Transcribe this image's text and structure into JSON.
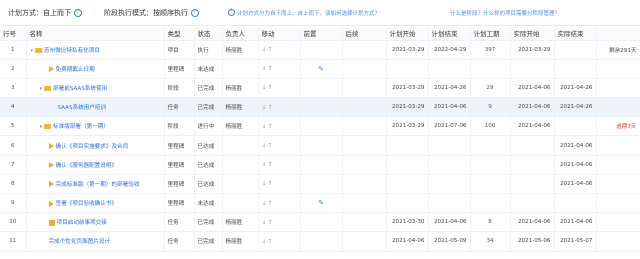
{
  "topbar": {
    "plan_mode_label": "计划方式：",
    "plan_mode_value": "自上而下",
    "stage_mode_label": "阶段执行模式：",
    "stage_mode_value": "按顺序执行",
    "hint_text": "计划方式分为自下而上、自上而下，该如何选择计划方式？",
    "hint2_text": "什么是阶段？什么样的项目需要分阶段管理？"
  },
  "columns": {
    "index": "行号",
    "name": "名称",
    "type": "类型",
    "status": "状态",
    "owner": "负责人",
    "move": "移动",
    "prev": "前置",
    "next": "后续",
    "plan_start": "计划开始",
    "plan_end": "计划结束",
    "plan_days": "计划工期",
    "actual_start": "实际开始",
    "actual_end": "实际结束"
  },
  "rows": [
    {
      "index": "1",
      "name": "苏州微比特私有化项目",
      "icon": "folder-icon",
      "indent": 0,
      "toggle": "▾",
      "type": "项目",
      "status": "执行",
      "owner": "杨丽胜",
      "move": "↓↑",
      "edit": false,
      "plan_start": "2021-03-29",
      "plan_end": "2022-04-29",
      "days": "397",
      "actual_start": "2021-03-29",
      "actual_end": "",
      "note": "剩余291天",
      "note_red": false,
      "selected": false
    },
    {
      "index": "2",
      "name": "免费期截止日期",
      "icon": "flag-icon",
      "indent": 2,
      "toggle": "",
      "type": "里程碑",
      "status": "未达成",
      "owner": "",
      "move": "↓↑",
      "edit": true,
      "plan_start": "",
      "plan_end": "",
      "days": "",
      "actual_start": "",
      "actual_end": "",
      "note": "",
      "note_red": false,
      "selected": false
    },
    {
      "index": "3",
      "name": "部署前SAAS系统使用",
      "icon": "folder-icon",
      "indent": 1,
      "toggle": "▾",
      "type": "阶段",
      "status": "已完成",
      "owner": "杨丽胜",
      "move": "↓↑",
      "edit": false,
      "plan_start": "2021-03-29",
      "plan_end": "2021-04-26",
      "days": "29",
      "actual_start": "2021-04-06",
      "actual_end": "2021-04-26",
      "note": "",
      "note_red": false,
      "selected": false
    },
    {
      "index": "4",
      "name": "SAAS系统用户培训",
      "icon": "",
      "indent": 3,
      "toggle": "",
      "type": "任务",
      "status": "已完成",
      "owner": "杨丽胜",
      "move": "↓↑",
      "edit": false,
      "plan_start": "2021-03-29",
      "plan_end": "2021-04-06",
      "days": "9",
      "actual_start": "2021-04-06",
      "actual_end": "2021-04-26",
      "note": "",
      "note_red": false,
      "selected": true
    },
    {
      "index": "5",
      "name": "标准版部署（第一期）",
      "icon": "folder-icon",
      "indent": 1,
      "toggle": "▾",
      "type": "阶段",
      "status": "进行中",
      "owner": "杨丽胜",
      "move": "↓↑",
      "edit": false,
      "plan_start": "2021-03-29",
      "plan_end": "2021-07-06",
      "days": "100",
      "actual_start": "2021-04-06",
      "actual_end": "",
      "note": "逾期7天",
      "note_red": true,
      "selected": false
    },
    {
      "index": "6",
      "name": "确认《项目实施要求》及合同",
      "icon": "flag-icon",
      "indent": 2,
      "toggle": "",
      "type": "里程碑",
      "status": "已达成",
      "owner": "",
      "move": "↓↑",
      "edit": false,
      "plan_start": "",
      "plan_end": "",
      "days": "",
      "actual_start": "",
      "actual_end": "2021-04-06",
      "note": "",
      "note_red": false,
      "selected": false
    },
    {
      "index": "7",
      "name": "确认《服务器配置说明》",
      "icon": "flag-icon",
      "indent": 2,
      "toggle": "",
      "type": "里程碑",
      "status": "已达成",
      "owner": "",
      "move": "↓↑",
      "edit": false,
      "plan_start": "",
      "plan_end": "",
      "days": "",
      "actual_start": "",
      "actual_end": "2021-04-06",
      "note": "",
      "note_red": false,
      "selected": false
    },
    {
      "index": "8",
      "name": "完成标准版（第一期）的部署验收",
      "icon": "flag-icon",
      "indent": 2,
      "toggle": "",
      "type": "里程碑",
      "status": "已达成",
      "owner": "",
      "move": "↓↑",
      "edit": false,
      "plan_start": "",
      "plan_end": "",
      "days": "",
      "actual_start": "",
      "actual_end": "2021-04-06",
      "note": "",
      "note_red": false,
      "selected": false
    },
    {
      "index": "9",
      "name": "签署《项目验收确认书》",
      "icon": "flag-icon",
      "indent": 2,
      "toggle": "",
      "type": "里程碑",
      "status": "未达成",
      "owner": "",
      "move": "↓↑",
      "edit": true,
      "plan_start": "",
      "plan_end": "",
      "days": "",
      "actual_start": "",
      "actual_end": "",
      "note": "",
      "note_red": false,
      "selected": false
    },
    {
      "index": "10",
      "name": "项目启动前事项交接",
      "icon": "task-icon",
      "indent": 2,
      "toggle": "",
      "type": "任务",
      "status": "已完成",
      "owner": "杨丽胜",
      "move": "↓↑",
      "edit": false,
      "plan_start": "2021-03-30",
      "plan_end": "2021-04-06",
      "days": "8",
      "actual_start": "2021-04-06",
      "actual_end": "2021-04-06",
      "note": "",
      "note_red": false,
      "selected": false
    },
    {
      "index": "11",
      "name": "完成个性化页面图片设计",
      "icon": "",
      "indent": 2,
      "toggle": "",
      "type": "任务",
      "status": "已完成",
      "owner": "杨丽胜",
      "move": "↓↑",
      "edit": false,
      "plan_start": "2021-04-06",
      "plan_end": "2021-05-09",
      "days": "34",
      "actual_start": "2021-05-06",
      "actual_end": "2021-05-07",
      "note": "",
      "note_red": false,
      "selected": false
    }
  ]
}
